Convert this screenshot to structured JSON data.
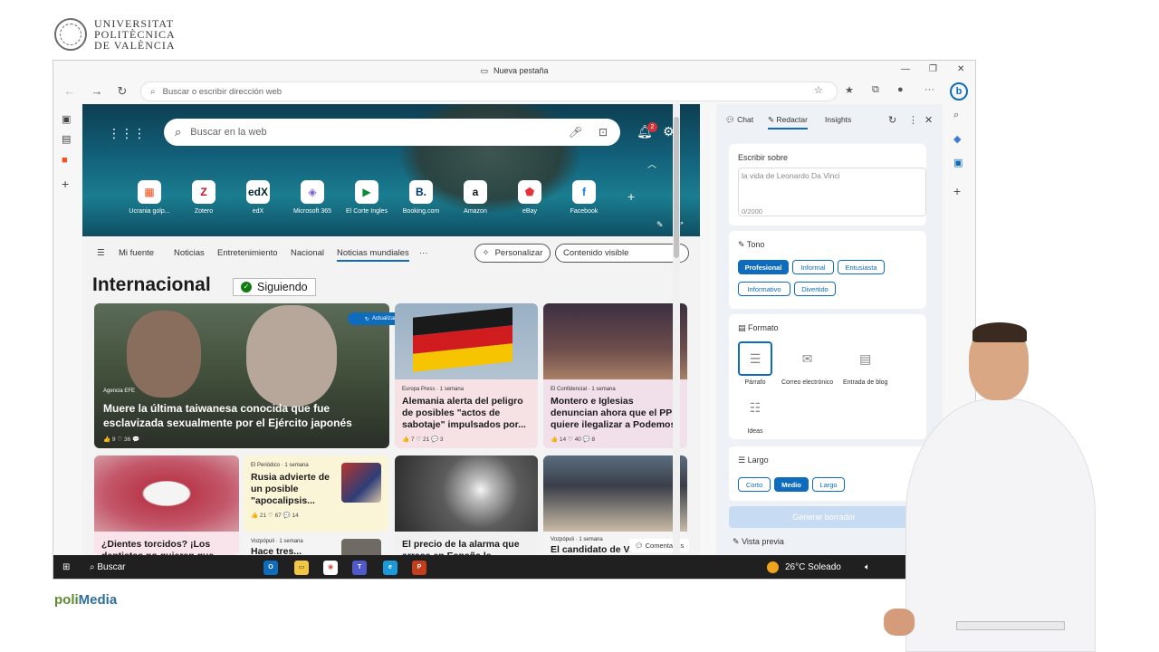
{
  "branding": {
    "university_lines": [
      "UNIVERSITAT",
      "POLITÈCNICA",
      "DE VALÈNCIA"
    ],
    "polimedia_a": "poli",
    "polimedia_b": "Media"
  },
  "window": {
    "title": "Nueva pestaña",
    "address_placeholder": "Buscar o escribir dirección web"
  },
  "newtab": {
    "search_placeholder": "Buscar en la web",
    "notifications_count": "2",
    "quick_links": [
      {
        "label": "Ucrania golp...",
        "glyph": "▦",
        "color": "#f25022"
      },
      {
        "label": "Zotero",
        "glyph": "Z",
        "color": "#c8102e"
      },
      {
        "label": "edX",
        "glyph": "edX",
        "color": "#02262b"
      },
      {
        "label": "Microsoft 365",
        "glyph": "◈",
        "color": "#7a5cd6"
      },
      {
        "label": "El Corte Ingles",
        "glyph": "▶",
        "color": "#0c8a3f"
      },
      {
        "label": "Booking.com",
        "glyph": "B.",
        "color": "#003580"
      },
      {
        "label": "Amazon",
        "glyph": "a",
        "color": "#111111"
      },
      {
        "label": "eBay",
        "glyph": "⬟",
        "color": "#e53238"
      },
      {
        "label": "Facebook",
        "glyph": "f",
        "color": "#1877f2"
      }
    ]
  },
  "feed": {
    "nav": [
      "Mi fuente",
      "Noticias",
      "Entretenimiento",
      "Nacional",
      "Noticias mundiales",
      "···"
    ],
    "personalizar": "Personalizar",
    "contenido": "Contenido visible",
    "heading": "Internacional",
    "following": "Siguiendo",
    "refresh": "Actualizar historias",
    "comments": "Comentarios",
    "cards": {
      "big": {
        "source": "Agencia EFE",
        "title": "Muere la última taiwanesa conocida que fue esclavizada sexualmente por el Ejército japonés",
        "meta": "👍 9   ♡ 36   💬"
      },
      "ale": {
        "source": "Europa Press · 1 semana",
        "title": "Alemania alerta del peligro de posibles \"actos de sabotaje\" impulsados por...",
        "meta": "👍 7   ♡ 21   💬 3"
      },
      "mon": {
        "source": "El Confidencial · 1 semana",
        "title": "Montero e Iglesias denuncian ahora que el PP quiere ilegalizar a Podemos",
        "meta": "👍 14   ♡ 40   💬 8"
      },
      "die": {
        "title": "¿Dientes torcidos? ¡Los dentistas no quieren que..."
      },
      "rus": {
        "source": "El Periódico · 1 semana",
        "title": "Rusia advierte de un posible \"apocalipsis...",
        "meta": "👍 21   ♡ 67   💬 14"
      },
      "vozp": {
        "source": "Vozpópuli · 1 semana",
        "title": "Hace tres..."
      },
      "ala": {
        "title": "El precio de la alarma que arrasa en España le..."
      },
      "can": {
        "source": "Vozpópuli · 1 semana",
        "title": "El candidato de Vox..."
      }
    }
  },
  "copilot": {
    "tabs": [
      "Chat",
      "Redactar",
      "Insights"
    ],
    "write_about_label": "Escribir sobre",
    "write_about_placeholder": "la vida de Leonardo Da Vinci",
    "char_count": "0/2000",
    "tone_label": "Tono",
    "tone_options": [
      "Profesional",
      "Informal",
      "Entusiasta",
      "Informativo",
      "Divertido"
    ],
    "tone_selected": "Profesional",
    "format_label": "Formato",
    "format_options": [
      "Párrafo",
      "Correo electrónico",
      "Entrada de blog",
      "Ideas"
    ],
    "format_selected": "Párrafo",
    "length_label": "Largo",
    "length_options": [
      "Corto",
      "Medio",
      "Largo"
    ],
    "length_selected": "Medio",
    "generate": "Generar borrador",
    "preview": "Vista previa"
  },
  "taskbar": {
    "search": "Buscar",
    "weather": "26°C  Soleado"
  }
}
